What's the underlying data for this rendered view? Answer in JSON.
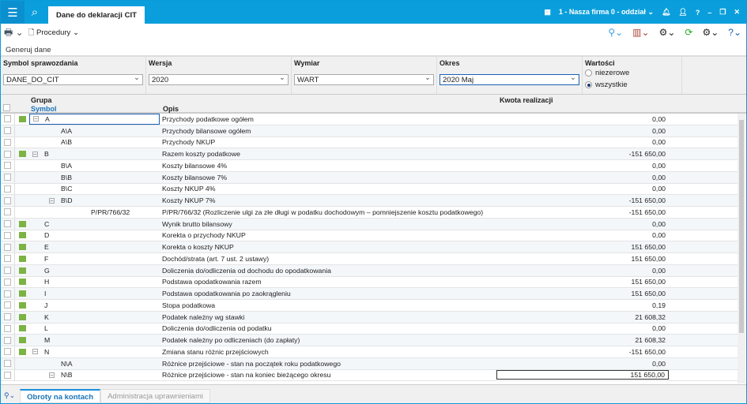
{
  "app": {
    "tab_title": "Dane do deklaracji CIT",
    "company": "1 - Nasza firma 0 - oddział"
  },
  "toolbar": {
    "procedury": "Procedury",
    "generuj": "Generuj dane"
  },
  "filters": {
    "symbol_label": "Symbol sprawozdania",
    "symbol_value": "DANE_DO_CIT",
    "wersja_label": "Wersja",
    "wersja_value": "2020",
    "wymiar_label": "Wymiar",
    "wymiar_value": "WART",
    "okres_label": "Okres",
    "okres_value": "2020 Maj",
    "wartosci_label": "Wartości",
    "opt1": "niezerowe",
    "opt2": "wszystkie",
    "selected": "wszystkie"
  },
  "grid": {
    "grupa": "Grupa",
    "symbol": "Symbol",
    "opis": "Opis",
    "kwota": "Kwota realizacji",
    "rows": [
      {
        "s": "A",
        "l": 0,
        "e": 1,
        "g": 1,
        "o": "Przychody podatkowe ogółem",
        "k": "0,00"
      },
      {
        "s": "A\\A",
        "l": 1,
        "e": 0,
        "g": 0,
        "o": "Przychody bilansowe ogółem",
        "k": "0,00"
      },
      {
        "s": "A\\B",
        "l": 1,
        "e": 0,
        "g": 0,
        "o": "Przychody NKUP",
        "k": "0,00"
      },
      {
        "s": "B",
        "l": 0,
        "e": 1,
        "g": 1,
        "o": "Razem koszty podatkowe",
        "k": "-151 650,00"
      },
      {
        "s": "B\\A",
        "l": 1,
        "e": 0,
        "g": 0,
        "o": "Koszty bilansowe 4%",
        "k": "0,00"
      },
      {
        "s": "B\\B",
        "l": 1,
        "e": 0,
        "g": 0,
        "o": "Koszty bilansowe 7%",
        "k": "0,00"
      },
      {
        "s": "B\\C",
        "l": 1,
        "e": 0,
        "g": 0,
        "o": "Koszty NKUP 4%",
        "k": "0,00"
      },
      {
        "s": "B\\D",
        "l": 1,
        "e": 1,
        "g": 0,
        "o": "Koszty NKUP 7%",
        "k": "-151 650,00"
      },
      {
        "s": "P/PR/766/32",
        "l": 2,
        "e": 0,
        "g": 0,
        "o": "P/PR/766/32  (Rozliczenie ulgi za złe długi w podatku dochodowym – pomniejszenie kosztu podatkowego)",
        "k": "-151 650,00"
      },
      {
        "s": "C",
        "l": 0,
        "e": 0,
        "g": 1,
        "o": "Wynik brutto bilansowy",
        "k": "0,00"
      },
      {
        "s": "D",
        "l": 0,
        "e": 0,
        "g": 1,
        "o": "Korekta o przychody NKUP",
        "k": "0,00"
      },
      {
        "s": "E",
        "l": 0,
        "e": 0,
        "g": 1,
        "o": "Korekta o koszty NKUP",
        "k": "151 650,00"
      },
      {
        "s": "F",
        "l": 0,
        "e": 0,
        "g": 1,
        "o": "Dochód/strata (art. 7 ust. 2 ustawy)",
        "k": "151 650,00"
      },
      {
        "s": "G",
        "l": 0,
        "e": 0,
        "g": 1,
        "o": "Doliczenia do/odliczenia od dochodu do opodatkowania",
        "k": "0,00"
      },
      {
        "s": "H",
        "l": 0,
        "e": 0,
        "g": 1,
        "o": "Podstawa opodatkowania razem",
        "k": "151 650,00"
      },
      {
        "s": "I",
        "l": 0,
        "e": 0,
        "g": 1,
        "o": "Podstawa opodatkowania po zaokrągleniu",
        "k": "151 650,00"
      },
      {
        "s": "J",
        "l": 0,
        "e": 0,
        "g": 1,
        "o": "Stopa podatkowa",
        "k": "0,19"
      },
      {
        "s": "K",
        "l": 0,
        "e": 0,
        "g": 1,
        "o": "Podatek należny wg stawki",
        "k": "21 608,32"
      },
      {
        "s": "L",
        "l": 0,
        "e": 0,
        "g": 1,
        "o": "Doliczenia do/odliczenia od podatku",
        "k": "0,00"
      },
      {
        "s": "M",
        "l": 0,
        "e": 0,
        "g": 1,
        "o": "Podatek należny po odliczeniach (do zapłaty)",
        "k": "21 608,32"
      },
      {
        "s": "N",
        "l": 0,
        "e": 1,
        "g": 1,
        "o": "Zmiana stanu różnic przejściowych",
        "k": "-151 650,00"
      },
      {
        "s": "N\\A",
        "l": 1,
        "e": 0,
        "g": 0,
        "o": "Różnice przejściowe - stan na początek roku podatkowego",
        "k": "0,00"
      },
      {
        "s": "N\\B",
        "l": 1,
        "e": 1,
        "g": 0,
        "o": "Różnice przejściowe - stan na koniec bieżącego okresu",
        "k": "151 650,00"
      }
    ]
  },
  "bottom_tabs": [
    "Obroty na kontach",
    "Administracja uprawnieniami"
  ],
  "colors": {
    "accent": "#0a9fdc",
    "marker": "#7cb342"
  }
}
